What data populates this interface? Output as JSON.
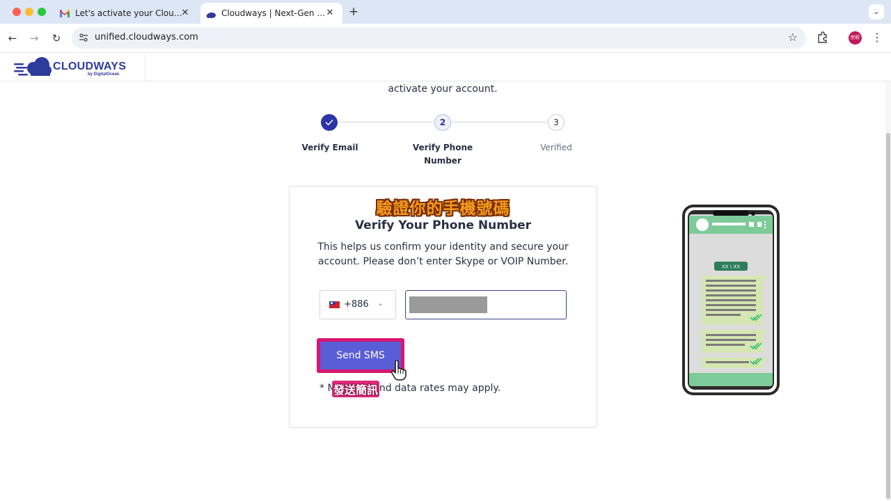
{
  "browser": {
    "tabs": [
      {
        "title": "Let's activate your Cloudways",
        "active": false
      },
      {
        "title": "Cloudways | Next-Gen Cloud",
        "active": true
      }
    ],
    "tab_close_glyph": "✕",
    "new_tab_glyph": "+",
    "tab_menu_glyph": "⌄",
    "nav": {
      "back": "←",
      "forward": "→",
      "reload": "↻"
    },
    "url": "unified.cloudways.com",
    "bookmark_glyph": "☆",
    "menu_glyph": "⋮",
    "profile_initials": "宗昕"
  },
  "header": {
    "logo_text": "CLOUDWAYS",
    "logo_sub": "by DigitalOcean"
  },
  "intro_tail": "activate your account.",
  "steps": [
    {
      "number": "✓",
      "label": "Verify Email",
      "state": "done"
    },
    {
      "number": "2",
      "label": "Verify Phone Number",
      "state": "current"
    },
    {
      "number": "3",
      "label": "Verified",
      "state": "pending"
    }
  ],
  "card": {
    "zh_title": "驗證你的手機號碼",
    "title": "Verify Your Phone Number",
    "description": "This helps us confirm your identity and secure your account. Please don’t enter Skype or VOIP Number.",
    "country_code": "+886",
    "chevron_glyph": "⌄",
    "send_button": "Send SMS",
    "fine_print": "* Message and data rates may apply.",
    "zh_send_label": "發送簡訊"
  },
  "illustration": {
    "chat_date_label": "XX \\ XX"
  },
  "colors": {
    "brand": "#2f3a9d",
    "button": "#5a5ed6",
    "highlight": "#d9166f",
    "chat_green": "#7ecb9a"
  },
  "icons": [
    "gmail-icon",
    "cloudways-icon",
    "site-info-icon",
    "bookmark-star-icon",
    "extensions-icon",
    "check-icon",
    "chevron-down-icon",
    "hand-cursor-icon"
  ]
}
